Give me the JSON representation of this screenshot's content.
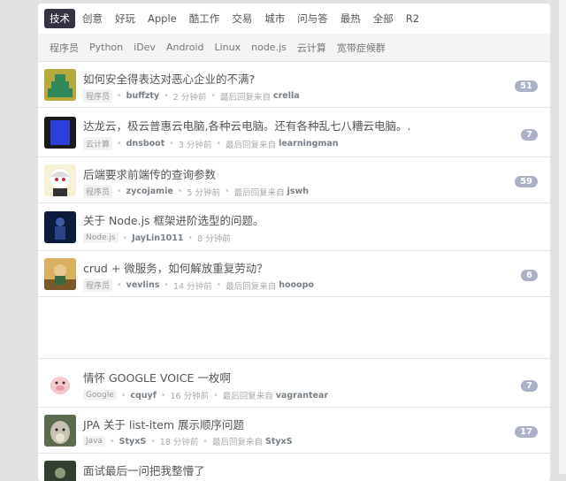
{
  "tabs": [
    "技术",
    "创意",
    "好玩",
    "Apple",
    "酷工作",
    "交易",
    "城市",
    "问与答",
    "最热",
    "全部",
    "R2"
  ],
  "subtabs": [
    "程序员",
    "Python",
    "iDev",
    "Android",
    "Linux",
    "node.js",
    "云计算",
    "宽带症候群"
  ],
  "topics": [
    {
      "title": "如何安全得表达对恶心企业的不满?",
      "node": "程序员",
      "user": "buffzty",
      "time": "2 分钟前",
      "last_label": "最后回复来自",
      "replier": "crella",
      "count": "51"
    },
    {
      "title": "达龙云，极云普惠云电脑,各种云电脑。还有各种乱七八糟云电脑。.",
      "node": "云计算",
      "user": "dnsboot",
      "time": "3 分钟前",
      "last_label": "最后回复来自",
      "replier": "learningman",
      "count": "7"
    },
    {
      "title": "后端要求前端传的查询参数",
      "node": "程序员",
      "user": "zycojamie",
      "time": "5 分钟前",
      "last_label": "最后回复来自",
      "replier": "jswh",
      "count": "59"
    },
    {
      "title": "关于 Node.js 框架进阶选型的问题。",
      "node": "Node.js",
      "user": "JayLin1011",
      "time": "8 分钟前",
      "last_label": "",
      "replier": "",
      "count": ""
    },
    {
      "title": "crud + 微服务，如何解放重复劳动？",
      "node": "程序员",
      "user": "vevlins",
      "time": "14 分钟前",
      "last_label": "最后回复来自",
      "replier": "hooopo",
      "count": "6"
    },
    {
      "title": "情怀 GOOGLE VOICE 一枚啊",
      "node": "Google",
      "user": "cquyf",
      "time": "16 分钟前",
      "last_label": "最后回复来自",
      "replier": "vagrantear",
      "count": "7"
    },
    {
      "title": "JPA 关于 list-item 展示顺序问题",
      "node": "Java",
      "user": "StyxS",
      "time": "18 分钟前",
      "last_label": "最后回复来自",
      "replier": "StyxS",
      "count": "17"
    },
    {
      "title": "面试最后一问把我整懵了",
      "node": "",
      "user": "",
      "time": "",
      "last_label": "",
      "replier": "",
      "count": ""
    }
  ],
  "colors": {
    "active_tab": "#333344",
    "count_badge": "#aab0c6"
  }
}
